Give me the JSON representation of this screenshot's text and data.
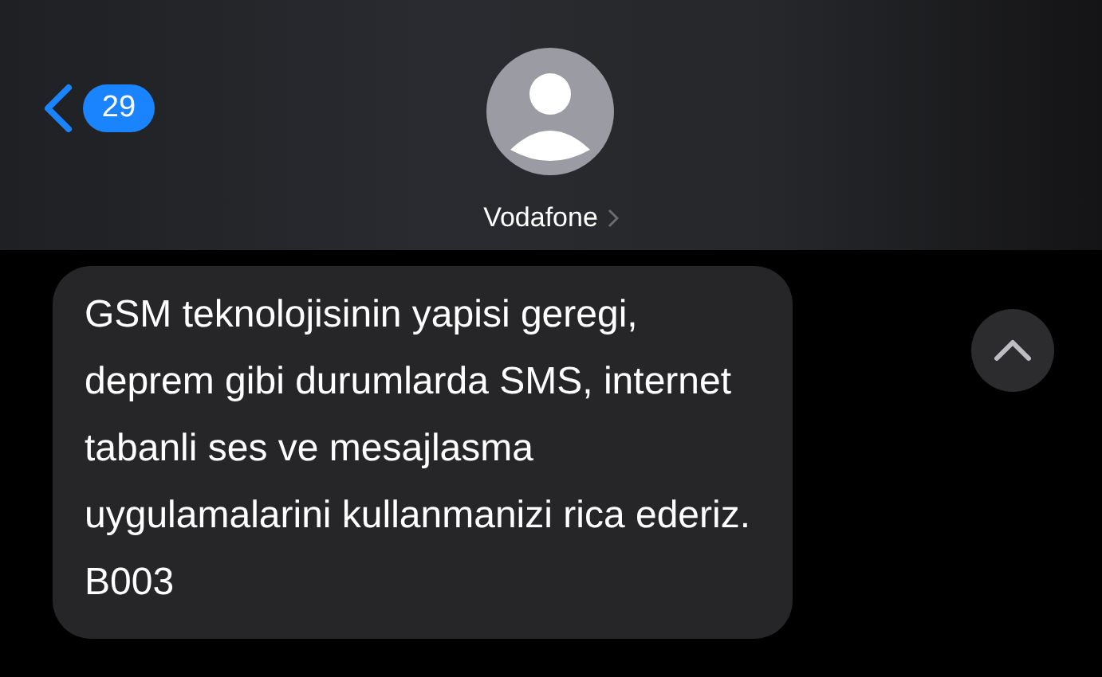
{
  "header": {
    "back_badge": "29",
    "contact_name": "Vodafone"
  },
  "messages": [
    {
      "kind": "incoming",
      "text": "GSM teknolojisinin yapisi geregi,\ndeprem gibi durumlarda SMS, internet\ntabanli ses ve mesajlasma\nuygulamalarini kullanmanizi rica ederiz.\nB003"
    }
  ]
}
